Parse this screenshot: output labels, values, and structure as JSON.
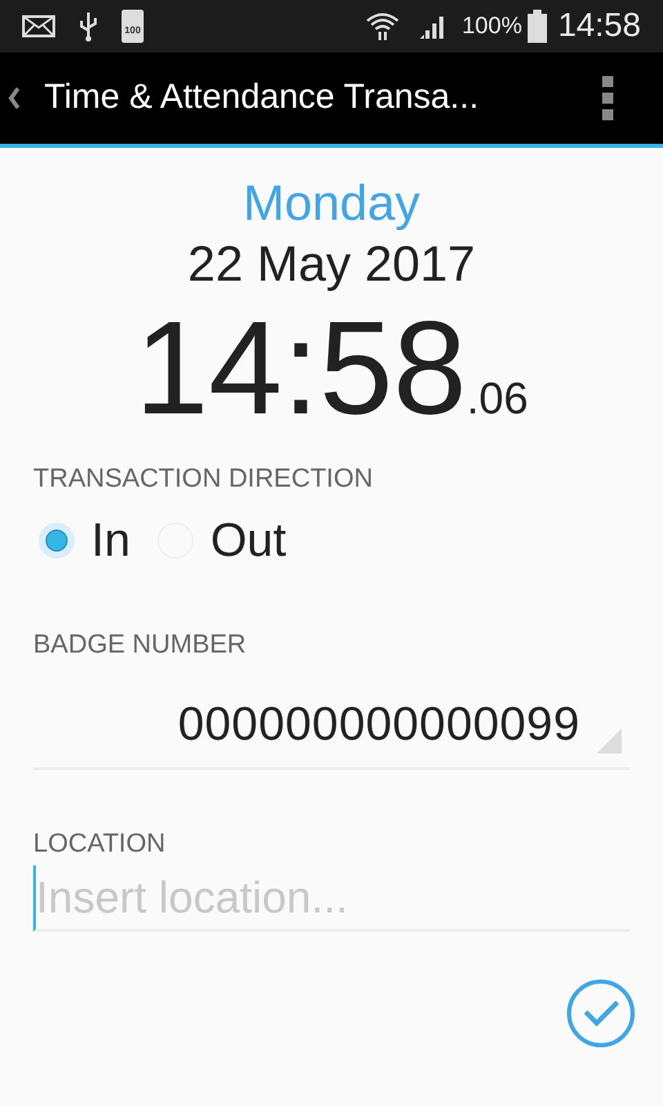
{
  "status_bar": {
    "battery_badge": "100",
    "battery_percent": "100%",
    "time": "14:58"
  },
  "app_bar": {
    "title": "Time & Attendance Transa..."
  },
  "date": {
    "weekday": "Monday",
    "date": "22 May 2017"
  },
  "clock": {
    "time": "14:58",
    "seconds": ".06"
  },
  "direction": {
    "label": "TRANSACTION DIRECTION",
    "options": [
      {
        "label": "In",
        "selected": true
      },
      {
        "label": "Out",
        "selected": false
      }
    ]
  },
  "badge": {
    "label": "BADGE NUMBER",
    "value": "000000000000099"
  },
  "location": {
    "label": "LOCATION",
    "placeholder": "Insert location...",
    "focused": true
  }
}
